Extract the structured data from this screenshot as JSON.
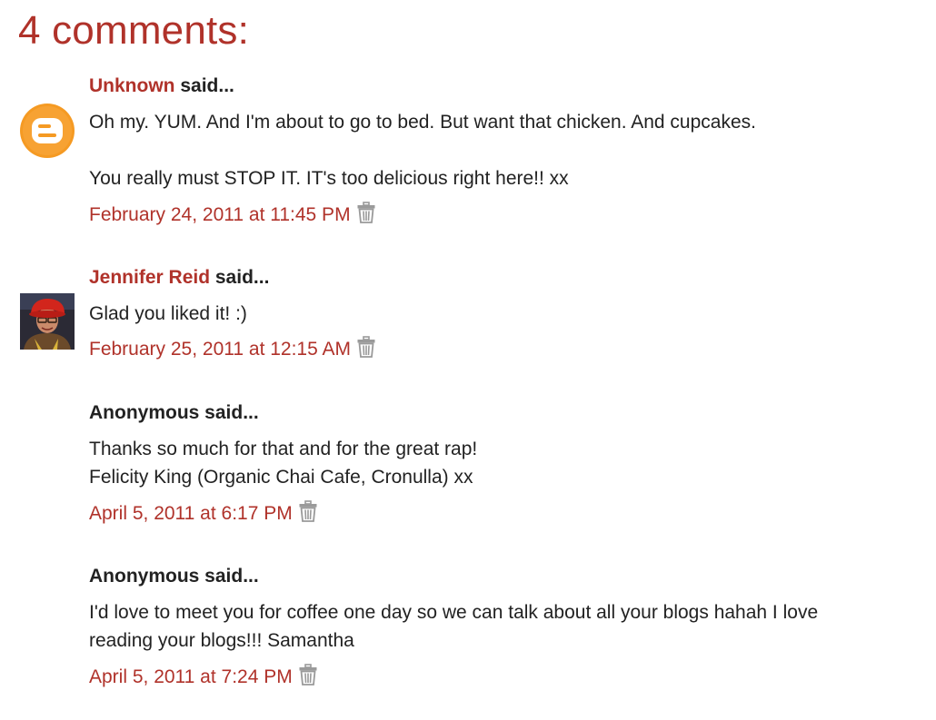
{
  "comments_heading": "4 comments:",
  "said_suffix": " said...",
  "icons": {
    "avatar_default": "blogger-logo-icon",
    "avatar_photo": "user-photo-avatar",
    "delete": "trash-icon"
  },
  "colors": {
    "accent": "#b0322a",
    "text": "#222222",
    "blogger_orange": "#f59a23",
    "trash_gray": "#9a9a9a"
  },
  "comments": [
    {
      "author": "Unknown",
      "author_is_link": true,
      "avatar": "blogger-logo-icon",
      "paragraphs": [
        "Oh my. YUM. And I'm about to go to bed. But want that chicken. And cupcakes.",
        "You really must STOP IT. IT's too delicious right here!! xx"
      ],
      "timestamp": "February 24, 2011 at 11:45 PM"
    },
    {
      "author": "Jennifer Reid",
      "author_is_link": true,
      "avatar": "user-photo-avatar",
      "paragraphs": [
        "Glad you liked it! :)"
      ],
      "timestamp": "February 25, 2011 at 12:15 AM"
    },
    {
      "author": "Anonymous",
      "author_is_link": false,
      "avatar": "",
      "paragraphs": [
        "Thanks so much for that and for the great rap!",
        "Felicity King (Organic Chai Cafe, Cronulla) xx"
      ],
      "timestamp": "April 5, 2011 at 6:17 PM"
    },
    {
      "author": "Anonymous",
      "author_is_link": false,
      "avatar": "",
      "paragraphs": [
        "I'd love to meet you for coffee one day so we can talk about all your blogs hahah I love reading your blogs!!! Samantha"
      ],
      "timestamp": "April 5, 2011 at 7:24 PM"
    }
  ]
}
